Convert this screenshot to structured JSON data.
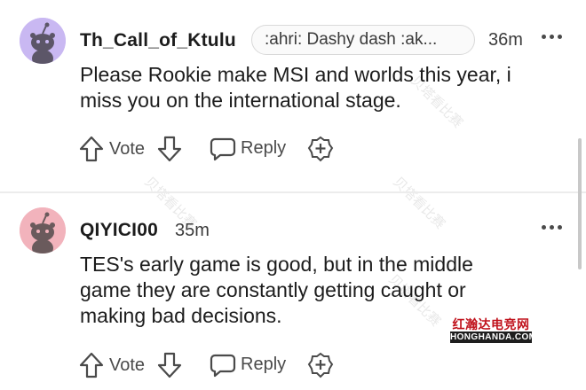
{
  "comments": [
    {
      "username": "Th_Call_of_Ktulu",
      "flair": ":ahri: Dashy dash :ak...",
      "time": "36m",
      "body_lines": [
        "Please Rookie make MSI and worlds this year, i",
        "miss you on the international stage."
      ],
      "vote_label": "Vote",
      "reply_label": "Reply",
      "avatar_color": "#c9b8f2"
    },
    {
      "username": "QIYICI00",
      "time": "35m",
      "body_lines": [
        "TES's early game is good, but in the middle",
        "game they are constantly getting caught or",
        "making bad decisions."
      ],
      "vote_label": "Vote",
      "reply_label": "Reply",
      "avatar_color": "#f2b3bc"
    }
  ],
  "watermarks": [
    "贝塔看比赛",
    "贝塔看比赛",
    "贝塔看比赛",
    "贝塔看比赛"
  ],
  "site_badge": {
    "cn": "红瀚达电竞网",
    "en": "HONGHANDA.COM"
  },
  "icons": [
    "snoo-avatar-icon",
    "more-options-icon",
    "upvote-arrow-icon",
    "downvote-arrow-icon",
    "reply-bubble-icon",
    "award-plus-icon"
  ]
}
